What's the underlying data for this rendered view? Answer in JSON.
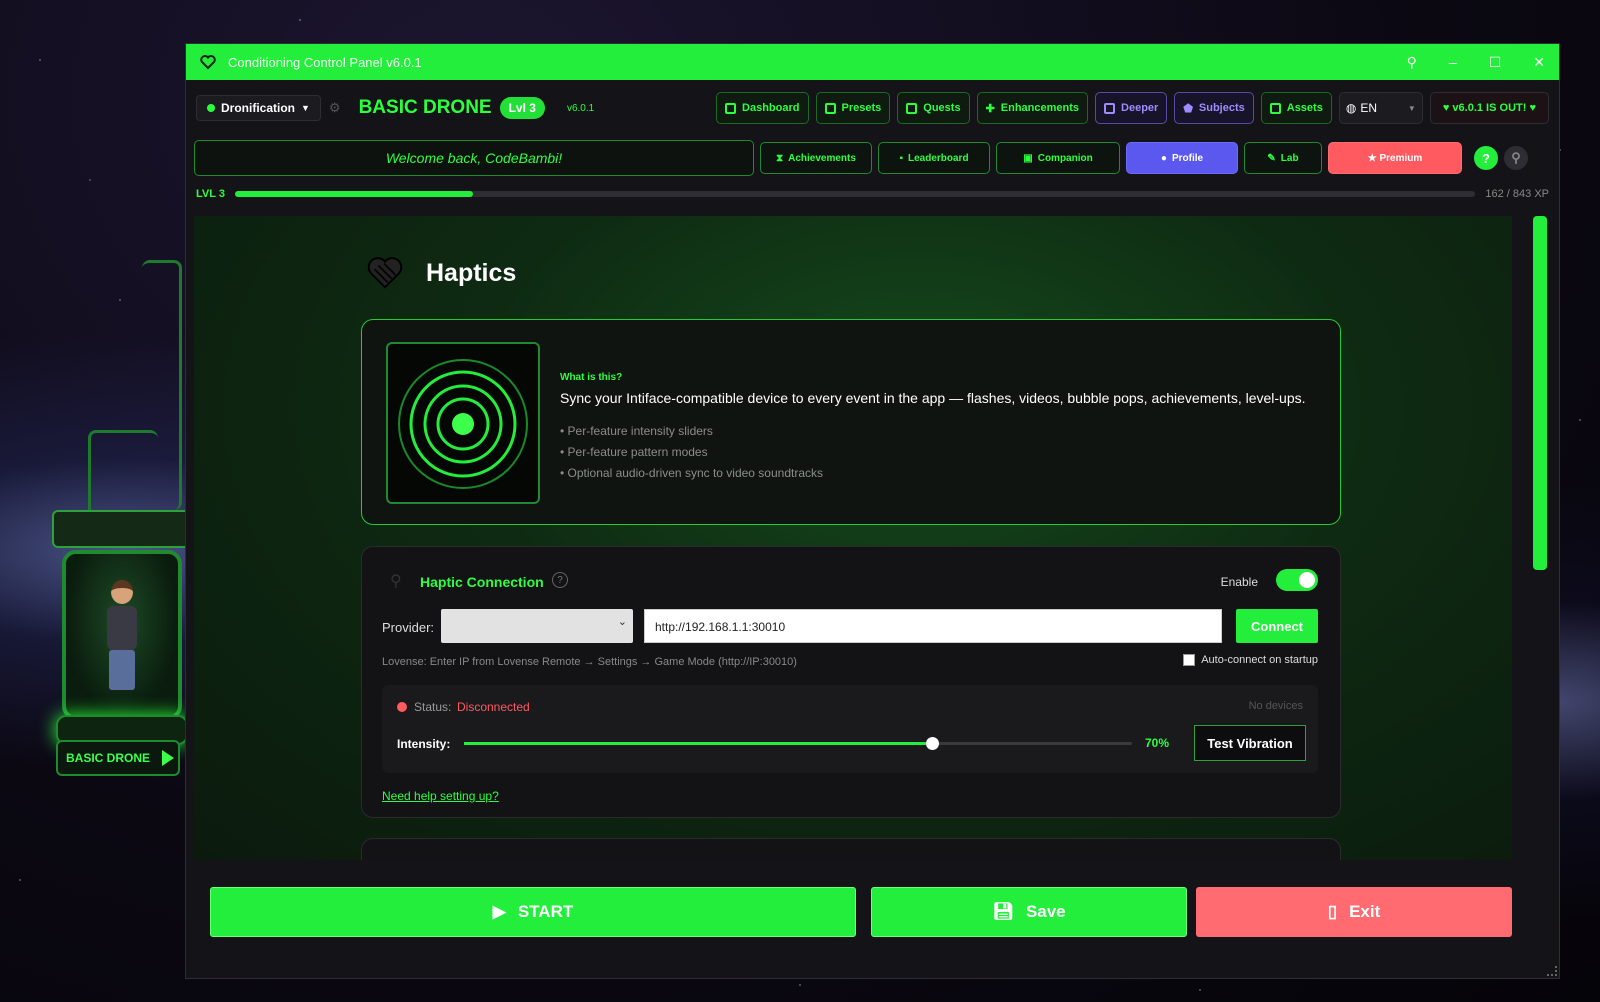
{
  "window": {
    "title": "Conditioning Control Panel v6.0.1"
  },
  "header": {
    "mode_dropdown": "Dronification",
    "brand": "BASIC DRONE",
    "level_pill": "Lvl 3",
    "version": "v6.0.1",
    "nav": [
      "Dashboard",
      "Presets",
      "Quests",
      "Enhancements",
      "Deeper",
      "Subjects",
      "Assets"
    ],
    "language": "EN",
    "update_badge": "v6.0.1 IS OUT!"
  },
  "subnav": {
    "welcome": "Welcome back, CodeBambi!",
    "tabs": [
      "Achievements",
      "Leaderboard",
      "Companion",
      "Profile",
      "Lab",
      "★ Premium"
    ],
    "active_tab": "Profile",
    "help": "?"
  },
  "xp": {
    "level": "LVL 3",
    "text": "162 / 843 XP",
    "fraction": 0.192
  },
  "avatar": {
    "label": "BASIC DRONE"
  },
  "page": {
    "title": "Haptics"
  },
  "info": {
    "what": "What is this?",
    "description": "Sync your Intiface-compatible device to every event in the app — flashes, videos, bubble pops, achievements, level-ups.",
    "bullets": [
      "• Per-feature intensity sliders",
      "• Per-feature pattern modes",
      "• Optional audio-driven sync to video soundtracks"
    ]
  },
  "connection": {
    "title": "Haptic Connection",
    "help": "?",
    "enable_label": "Enable",
    "enabled": true,
    "provider_label": "Provider:",
    "provider_value": "",
    "url": "http://192.168.1.1:30010",
    "connect": "Connect",
    "hint": "Lovense: Enter IP from Lovense Remote → Settings → Game Mode (http://IP:30010)",
    "auto_connect": "Auto-connect on startup",
    "auto_connect_checked": false,
    "status_label": "Status:",
    "status_value": "Disconnected",
    "devices": "No devices",
    "intensity_label": "Intensity:",
    "intensity_value": "70%",
    "intensity": 0.7,
    "test": "Test Vibration",
    "help_link": "Need help setting up?"
  },
  "footer": {
    "start": "START",
    "save": "Save",
    "exit": "Exit"
  },
  "colors": {
    "accent": "#22ee3b",
    "danger": "#ff6b70",
    "active_tab": "#5a58ee"
  }
}
